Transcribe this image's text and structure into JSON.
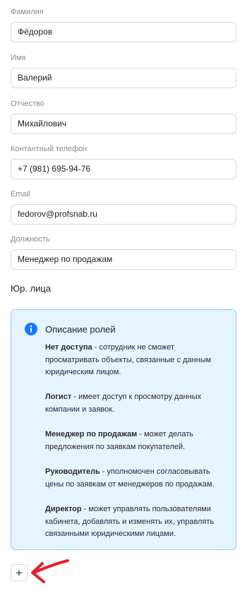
{
  "fields": [
    {
      "label": "Фамилия",
      "value": "Фёдоров"
    },
    {
      "label": "Имя",
      "value": "Валерий"
    },
    {
      "label": "Отчество",
      "value": "Михайлович"
    },
    {
      "label": "Контантный телефон",
      "value": "+7 (981) 695-94-76"
    },
    {
      "label": "Email",
      "value": "fedorov@profsnab.ru"
    },
    {
      "label": "Должность",
      "value": "Менеджер по продажам"
    }
  ],
  "section_title": "Юр. лица",
  "roles_info": {
    "title": "Описание ролей",
    "icon": "info-icon",
    "accent": "#1677ff",
    "roles": [
      {
        "name": "Нет доступа",
        "description": " - сотрудник не сможет просматривать объекты, связанные с данным юридическим лицом."
      },
      {
        "name": "Логист",
        "description": " - имеет доступ к просмотру данных компании и заявок."
      },
      {
        "name": "Менеджер по продажам",
        "description": " - может делать предложения по заявкам покупателей."
      },
      {
        "name": "Руководитель",
        "description": " - уполномочен согласовывать цены по заявкам от менеджеров по продажам."
      },
      {
        "name": "Директор",
        "description": " - может управлять пользователями кабинета, добавлять и изменять их, управлять связанными юридическими лицами."
      }
    ]
  },
  "add_button": {
    "label": "+"
  },
  "annotation": {
    "icon": "red-arrow-icon",
    "color": "#e4202a"
  }
}
